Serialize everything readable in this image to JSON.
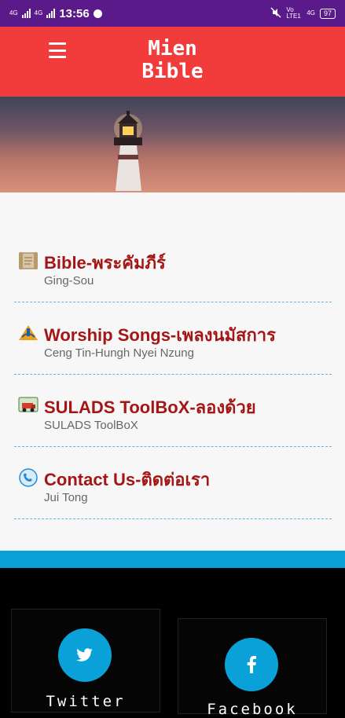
{
  "status": {
    "net1": "4G",
    "net2": "4G",
    "time": "13:56",
    "volte": "Vo LTE1",
    "net3": "4G",
    "battery": "97"
  },
  "appbar": {
    "title": "Mien\nBible"
  },
  "menu": [
    {
      "icon": "bible-scroll-icon",
      "title": "Bible-พระคัมภีร์",
      "subtitle": "Ging-Sou"
    },
    {
      "icon": "church-logo-icon",
      "title": "Worship Songs-เพลงนมัสการ",
      "subtitle": "Ceng Tin-Hungh Nyei Nzung"
    },
    {
      "icon": "toolbox-truck-icon",
      "title": "SULADS ToolBoX-ลองด้วย",
      "subtitle": "SULADS ToolBoX"
    },
    {
      "icon": "phone-contact-icon",
      "title": "Contact Us-ติดต่อเรา",
      "subtitle": "Jui Tong"
    }
  ],
  "social": [
    {
      "icon": "twitter-icon",
      "label": "Twitter"
    },
    {
      "icon": "facebook-icon",
      "label": "Facebook"
    }
  ],
  "colors": {
    "status_bar": "#5a1a8a",
    "app_bar": "#f23b3b",
    "item_title": "#a41616",
    "accent_blue": "#0aa1d8"
  }
}
